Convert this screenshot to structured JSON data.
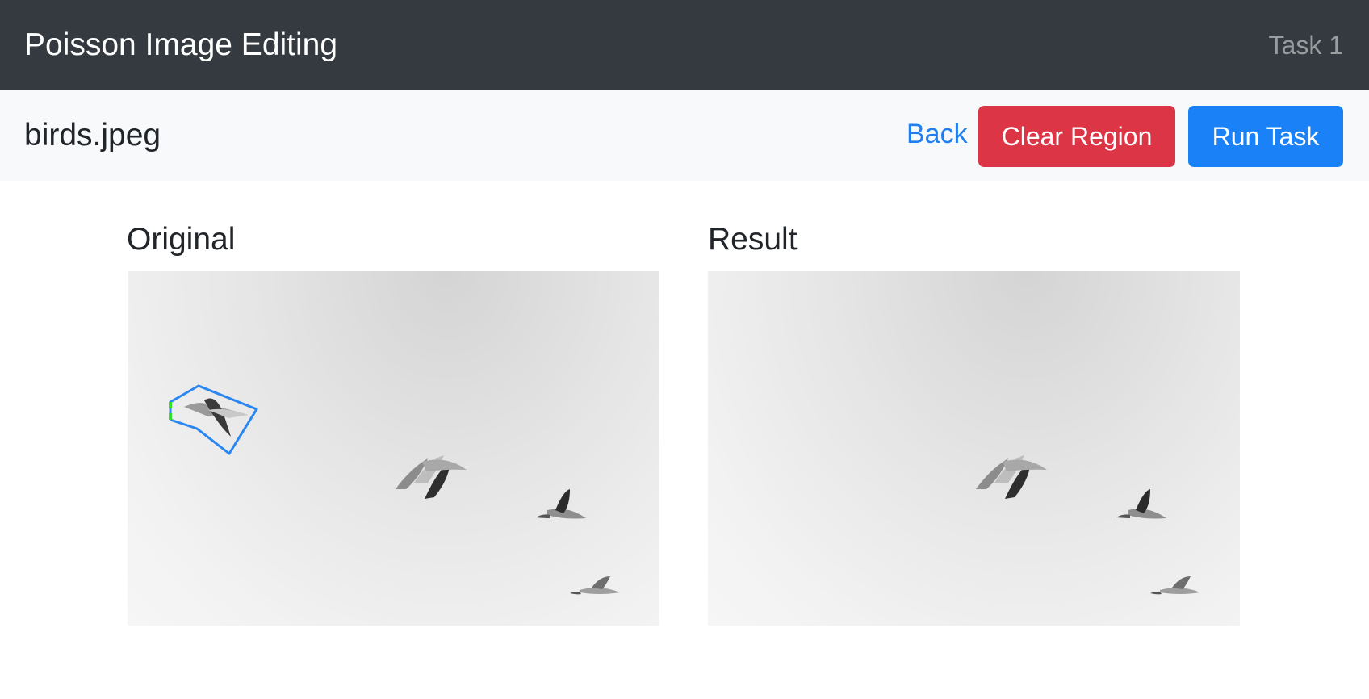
{
  "navbar": {
    "brand": "Poisson Image Editing",
    "task_label": "Task 1"
  },
  "toolbar": {
    "filename": "birds.jpeg",
    "back_label": "Back",
    "clear_label": "Clear Region",
    "run_label": "Run Task"
  },
  "panels": {
    "original_title": "Original",
    "result_title": "Result"
  },
  "colors": {
    "navbar_bg": "#343a40",
    "clear_button": "#dc3545",
    "run_button": "#1a82f6",
    "selection_outline": "#2a86f0",
    "selection_open_ends": "#33dd33"
  }
}
